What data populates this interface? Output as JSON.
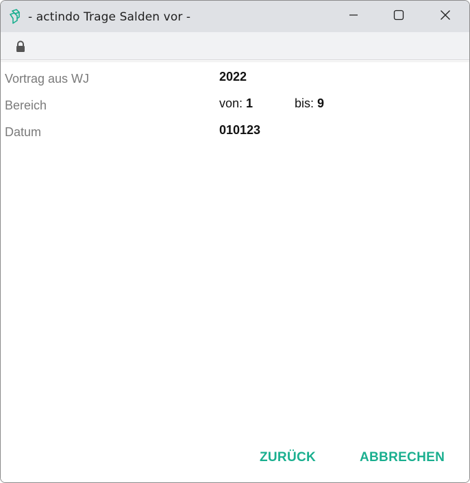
{
  "window": {
    "title": "- actindo Trage Salden vor -",
    "app_icon": "actindo-logo-icon",
    "controls": [
      "minimize-icon",
      "maximize-icon",
      "close-icon"
    ],
    "accent_color": "#1aaf8f"
  },
  "addressbar": {
    "icon": "lock-icon"
  },
  "form": {
    "vortrag": {
      "label": "Vortrag aus WJ",
      "value": "2022"
    },
    "bereich": {
      "label": "Bereich",
      "von_label": "von:",
      "von_value": "1",
      "bis_label": "bis:",
      "bis_value": "9"
    },
    "datum": {
      "label": "Datum",
      "value": "010123"
    }
  },
  "actions": {
    "back_label": "ZURÜCK",
    "cancel_label": "ABBRECHEN"
  }
}
